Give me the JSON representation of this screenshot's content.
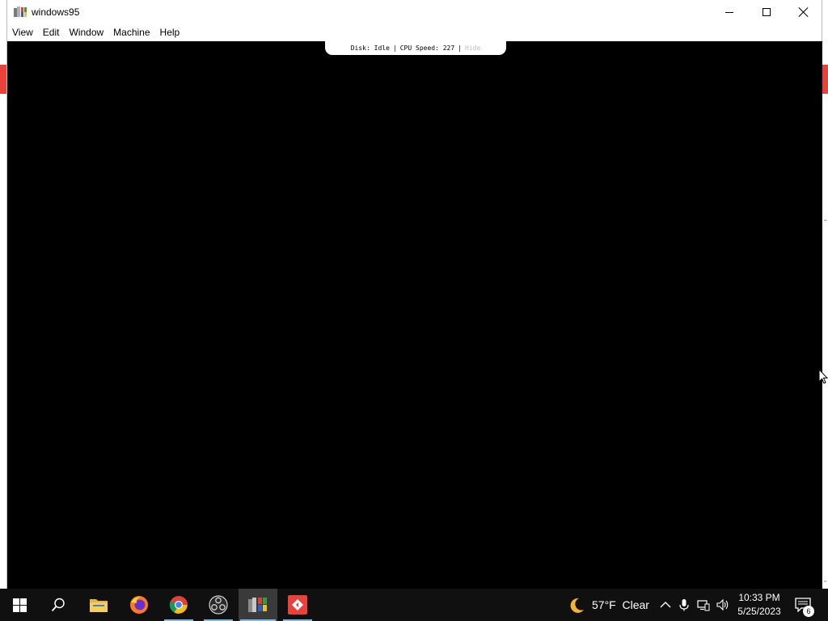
{
  "window": {
    "title": "windows95",
    "icon": "windows95-app-icon"
  },
  "menu": [
    {
      "label": "View"
    },
    {
      "label": "Edit"
    },
    {
      "label": "Window"
    },
    {
      "label": "Machine"
    },
    {
      "label": "Help"
    }
  ],
  "status": {
    "disk": "Disk: Idle",
    "cpu": "CPU Speed: 227",
    "separator": "|",
    "hide": "Hide"
  },
  "taskbar": {
    "items": [
      {
        "name": "start-button",
        "icon": "windows-logo-icon"
      },
      {
        "name": "search-button",
        "icon": "search-icon"
      },
      {
        "name": "file-explorer",
        "icon": "folder-icon"
      },
      {
        "name": "firefox",
        "icon": "firefox-icon"
      },
      {
        "name": "chrome",
        "icon": "chrome-icon"
      },
      {
        "name": "obs",
        "icon": "obs-icon"
      },
      {
        "name": "windows95-app",
        "icon": "windows95-icon"
      },
      {
        "name": "git-app",
        "icon": "git-icon"
      }
    ],
    "weather": {
      "temp": "57°F",
      "condition": "Clear",
      "icon": "moon-icon"
    },
    "tray_icons": [
      "chevron-up-icon",
      "microphone-icon",
      "network-icon",
      "volume-icon"
    ],
    "clock": {
      "time": "10:33 PM",
      "date": "5/25/2023"
    },
    "notifications": {
      "count": "6",
      "icon": "notification-icon"
    }
  },
  "colors": {
    "accent": "#76b9ed",
    "taskbar_bg": "#101010",
    "screen_bg": "#000000"
  }
}
